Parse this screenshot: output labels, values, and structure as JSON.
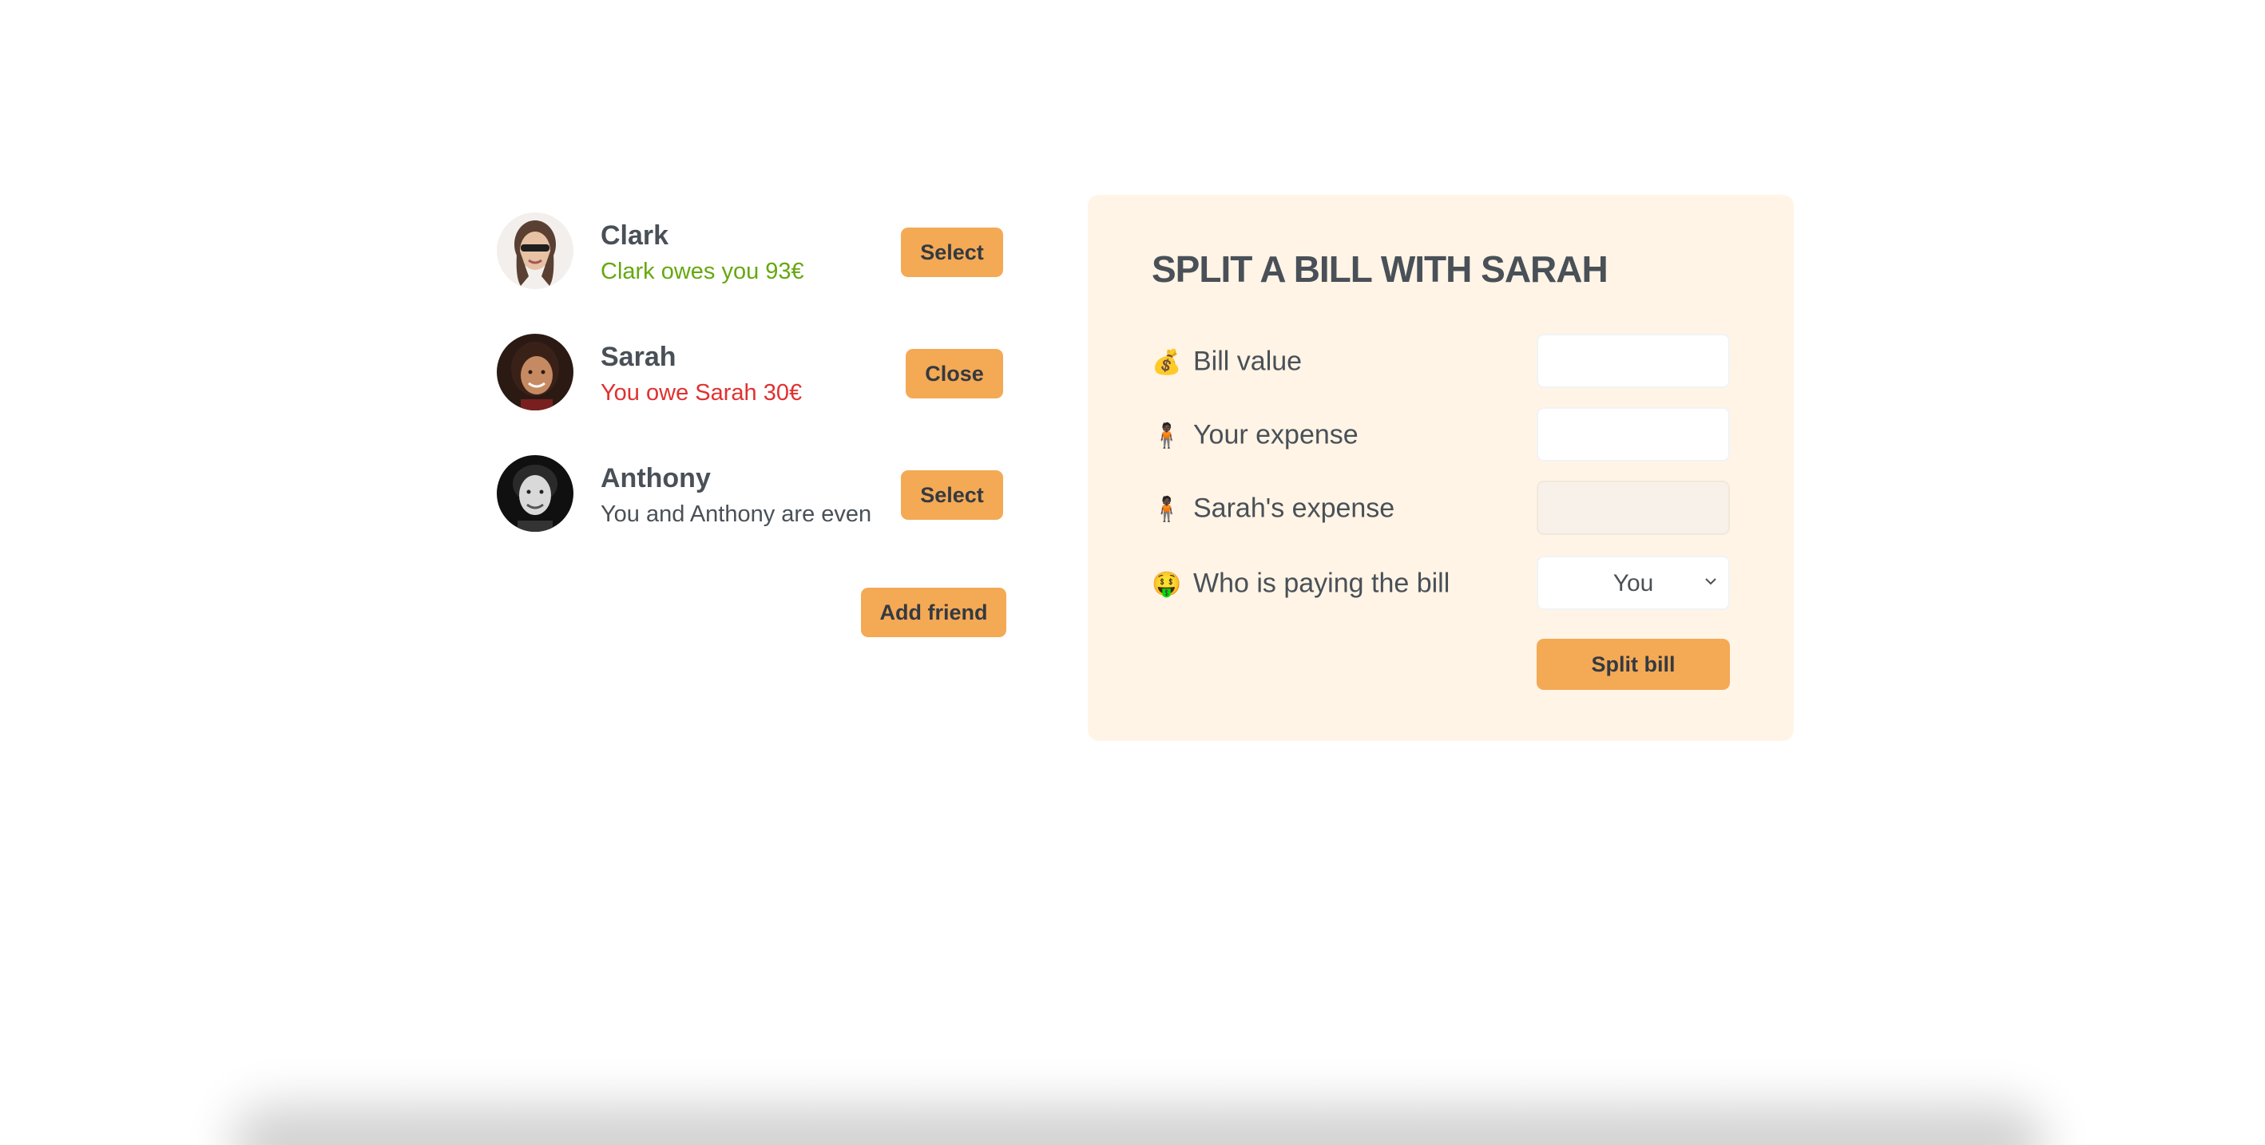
{
  "friends": [
    {
      "name": "Clark",
      "status": "Clark owes you 93€",
      "status_type": "green",
      "button_label": "Select",
      "avatar_icon": "avatar-clark"
    },
    {
      "name": "Sarah",
      "status": "You owe Sarah 30€",
      "status_type": "red",
      "button_label": "Close",
      "avatar_icon": "avatar-sarah"
    },
    {
      "name": "Anthony",
      "status": "You and Anthony are even",
      "status_type": "neutral",
      "button_label": "Select",
      "avatar_icon": "avatar-anthony"
    }
  ],
  "add_friend_label": "Add friend",
  "split_form": {
    "title": "SPLIT A BILL WITH SARAH",
    "bill_value": {
      "emoji": "💰",
      "label": "Bill value",
      "value": ""
    },
    "your_expense": {
      "emoji": "🧍🏿",
      "label": "Your expense",
      "value": ""
    },
    "friend_expense": {
      "emoji": "🧍🏿",
      "label": "Sarah's expense",
      "value": ""
    },
    "payer": {
      "emoji": "🤑",
      "label": "Who is paying the bill",
      "selected": "You"
    },
    "submit_label": "Split bill"
  },
  "colors": {
    "accent": "#f4a955",
    "form_background": "#fff4e6",
    "positive": "#66a80f",
    "negative": "#e03131",
    "text": "#495057"
  }
}
